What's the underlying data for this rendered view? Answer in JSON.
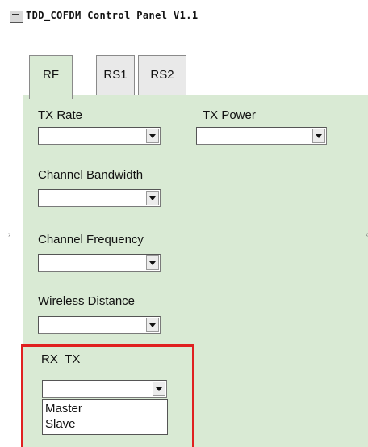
{
  "window": {
    "title": "TDD_COFDM Control Panel V1.1",
    "icon": "app-window-icon"
  },
  "tabs": [
    {
      "label": "RF",
      "active": true
    },
    {
      "label": "RS1",
      "active": false
    },
    {
      "label": "RS2",
      "active": false
    }
  ],
  "fields": {
    "tx_rate": {
      "label": "TX Rate",
      "value": ""
    },
    "tx_power": {
      "label": "TX Power",
      "value": ""
    },
    "channel_bandwidth": {
      "label": "Channel Bandwidth",
      "value": ""
    },
    "channel_frequency": {
      "label": "Channel Frequency",
      "value": ""
    },
    "wireless_distance": {
      "label": "Wireless Distance",
      "value": ""
    },
    "rx_tx": {
      "label": "RX_TX",
      "value": "",
      "options": [
        "Master",
        "Slave"
      ],
      "expanded": true
    }
  },
  "colors": {
    "panel_background": "#d9ead4",
    "tab_background": "#e9e9e9",
    "highlight_border": "#e02020"
  }
}
